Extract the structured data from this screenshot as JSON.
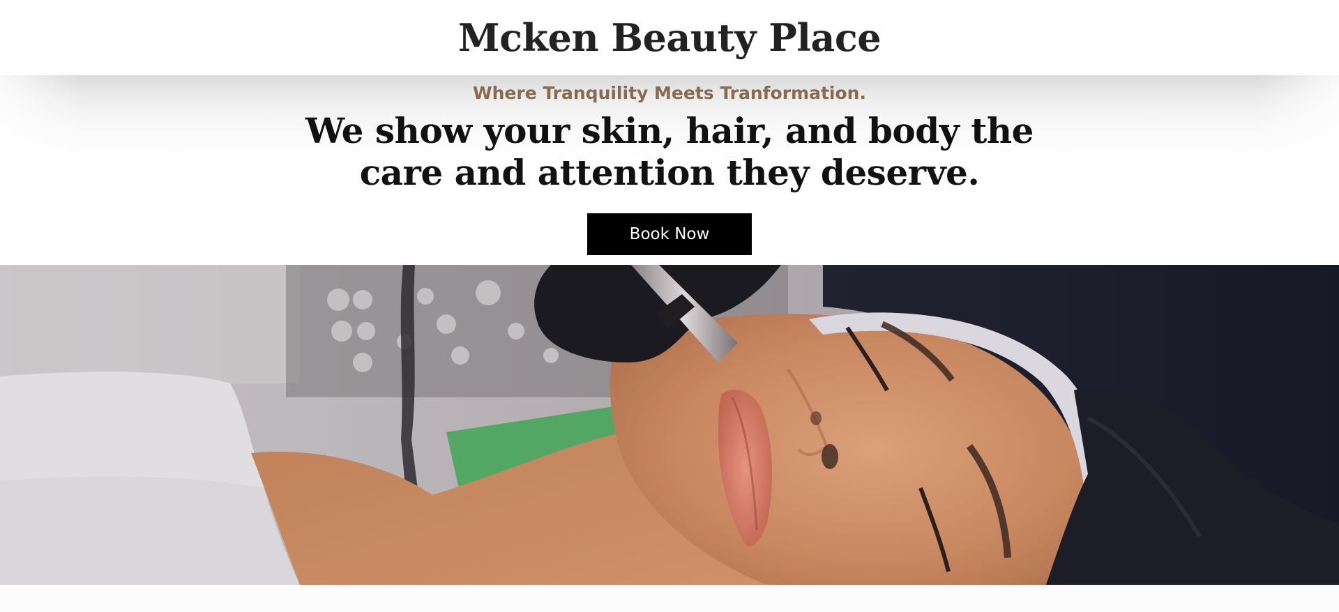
{
  "header": {
    "site_title": "Mcken Beauty Place"
  },
  "hero": {
    "tagline": "Where Tranquility Meets Tranformation.",
    "headline": "We show your skin, hair, and body the care and attention they deserve.",
    "cta_label": "Book Now",
    "image_subject": "facial-treatment-photo"
  },
  "colors": {
    "tagline": "#8a6a4f",
    "headline": "#111111",
    "button_bg": "#000000",
    "button_text": "#ffffff"
  }
}
